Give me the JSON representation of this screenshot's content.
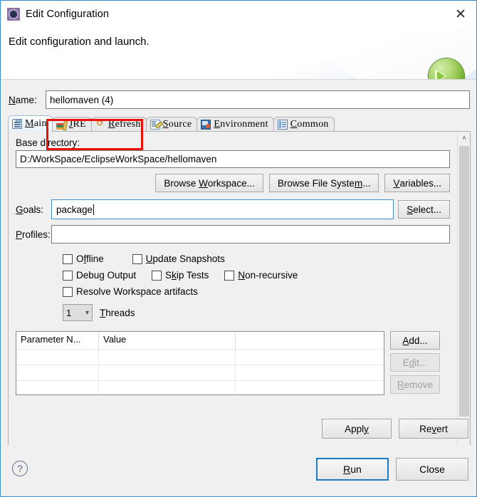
{
  "window": {
    "title": "Edit Configuration",
    "icon": "gear-icon",
    "close_label": "✕"
  },
  "header": {
    "title": "Edit configuration and launch.",
    "badge_icon": "run-play-icon"
  },
  "name_field": {
    "label": "Name:",
    "label_mnemonic": "N",
    "value": "hellomaven (4)"
  },
  "tabs": [
    {
      "label": "Main",
      "mnemonic": "M",
      "icon": "clipboard-icon",
      "selected": true
    },
    {
      "label": "JRE",
      "mnemonic": "J",
      "icon": "books-icon",
      "selected": false
    },
    {
      "label": "Refresh",
      "mnemonic": "R",
      "icon": "refresh-icon",
      "selected": false
    },
    {
      "label": "Source",
      "mnemonic": "S",
      "icon": "source-edit-icon",
      "selected": false
    },
    {
      "label": "Environment",
      "mnemonic": "E",
      "icon": "environment-icon",
      "selected": false
    },
    {
      "label": "Common",
      "mnemonic": "C",
      "icon": "common-icon",
      "selected": false
    }
  ],
  "main_tab": {
    "base_directory": {
      "label": "Base directory:",
      "value": "D:/WorkSpace/EclipseWorkSpace/hellomaven"
    },
    "browse_buttons": [
      {
        "label": "Browse Workspace...",
        "pre": "Browse ",
        "mnemonic": "W",
        "post": "orkspace..."
      },
      {
        "label": "Browse File System...",
        "pre": "Browse File Syste",
        "mnemonic": "m",
        "post": "..."
      },
      {
        "label": "Variables...",
        "pre": "",
        "mnemonic": "V",
        "post": "ariables..."
      }
    ],
    "goals": {
      "label": "Goals:",
      "label_pre": "",
      "label_mnemonic": "G",
      "label_post": "oals:",
      "value": "package",
      "highlighted": true,
      "highlight_color": "#e8120b",
      "focus_color": "#3f8fce",
      "select_button": {
        "pre": "",
        "mnemonic": "S",
        "post": "elect..."
      }
    },
    "profiles": {
      "label_pre": "",
      "label_mnemonic": "P",
      "label_post": "rofiles:",
      "value": ""
    },
    "checkboxes": [
      {
        "pre": "O",
        "mnemonic": "f",
        "post": "fline",
        "label": "Offline",
        "checked": false
      },
      {
        "pre": "",
        "mnemonic": "U",
        "post": "pdate Snapshots",
        "label": "Update Snapshots",
        "checked": false
      },
      {
        "pre": "Debu",
        "mnemonic": "g",
        "post": " Output",
        "label": "Debug Output",
        "checked": false
      },
      {
        "pre": "S",
        "mnemonic": "k",
        "post": "ip Tests",
        "label": "Skip Tests",
        "checked": false
      },
      {
        "pre": "",
        "mnemonic": "N",
        "post": "on-recursive",
        "label": "Non-recursive",
        "checked": false
      },
      {
        "pre": "Resolve Workspace artifacts",
        "mnemonic": "",
        "post": "",
        "label": "Resolve Workspace artifacts",
        "checked": false
      }
    ],
    "threads": {
      "value": "1",
      "chevron": "⌄",
      "label_pre": "",
      "label_mnemonic": "T",
      "label_post": "hreads"
    },
    "parameters_table": {
      "columns": [
        "Parameter N...",
        "Value",
        ""
      ],
      "rows": [
        [
          "",
          "",
          ""
        ],
        [
          "",
          "",
          ""
        ],
        [
          "",
          "",
          ""
        ]
      ],
      "buttons": [
        {
          "pre": "",
          "mnemonic": "A",
          "post": "dd...",
          "label": "Add...",
          "enabled": true
        },
        {
          "pre": "E",
          "mnemonic": "d",
          "post": "it...",
          "label": "Edit...",
          "enabled": false
        },
        {
          "pre": "",
          "mnemonic": "R",
          "post": "emove",
          "label": "Remove",
          "enabled": false
        }
      ]
    }
  },
  "apply_revert": [
    {
      "pre": "Appl",
      "mnemonic": "y",
      "post": "",
      "label": "Apply"
    },
    {
      "pre": "Re",
      "mnemonic": "v",
      "post": "ert",
      "label": "Revert"
    }
  ],
  "footer": {
    "help_icon": "question-mark-icon",
    "help_glyph": "?",
    "buttons": [
      {
        "pre": "",
        "mnemonic": "R",
        "post": "un",
        "label": "Run",
        "default": true
      },
      {
        "pre": "Close",
        "mnemonic": "",
        "post": "",
        "label": "Close",
        "default": false
      }
    ]
  },
  "scrollbar": {
    "up_glyph": "˄",
    "down_glyph": "˅"
  }
}
